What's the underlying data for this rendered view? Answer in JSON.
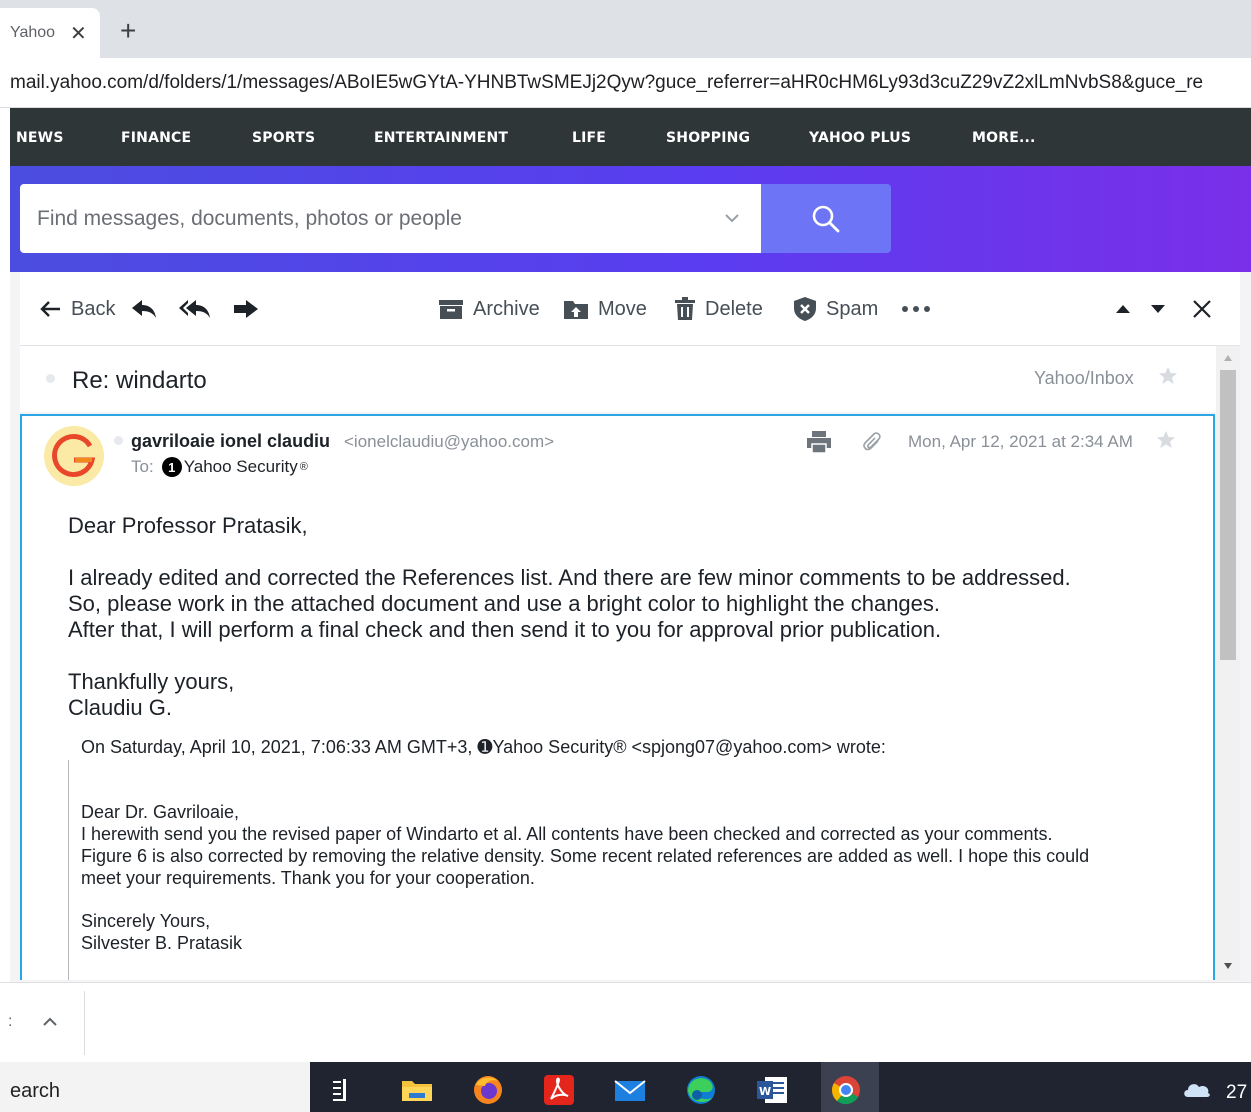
{
  "browser": {
    "tab_title": "Yahoo",
    "url": "mail.yahoo.com/d/folders/1/messages/ABoIE5wGYtA-YHNBTwSMEJj2Qyw?guce_referrer=aHR0cHM6Ly93d3cuZ29vZ2xlLmNvbS8&guce_re"
  },
  "nav": {
    "items": [
      "NEWS",
      "FINANCE",
      "SPORTS",
      "ENTERTAINMENT",
      "LIFE",
      "SHOPPING",
      "YAHOO PLUS",
      "MORE..."
    ]
  },
  "search": {
    "placeholder": "Find messages, documents, photos or people"
  },
  "toolbar": {
    "back_label": "Back",
    "archive_label": "Archive",
    "move_label": "Move",
    "delete_label": "Delete",
    "spam_label": "Spam"
  },
  "message": {
    "subject": "Re: windarto",
    "folder": "Yahoo/Inbox",
    "sender_name": "gavriloaie ionel claudiu",
    "sender_email": "<ionelclaudiu@yahoo.com>",
    "to_label": "To:",
    "to_badge": "1",
    "to_name": "Yahoo Security",
    "to_mark": "®",
    "date": "Mon, Apr 12, 2021 at 2:34 AM",
    "body": {
      "greeting": "Dear Professor Pratasik,",
      "line1": "I already edited and corrected the References list. And there are few minor comments to be addressed.",
      "line2": "So, please work in the attached document and use a bright color to highlight the changes.",
      "line3": "After that, I will perform a final check and then send it to you for approval prior publication.",
      "closing": "Thankfully yours,",
      "signature": "Claudiu G."
    },
    "quoted": {
      "header": "On Saturday, April 10, 2021, 7:06:33 AM GMT+3, ➊Yahoo Security® <spjong07@yahoo.com> wrote:",
      "greeting": "Dear Dr. Gavriloaie,",
      "line1": "I herewith send you the revised paper of Windarto et al. All contents have been checked and corrected as your comments.",
      "line2": "Figure 6 is also corrected by removing the relative density. Some recent related references are added as well. I hope this could",
      "line3": "meet your requirements. Thank you for your cooperation.",
      "closing": "Sincerely Yours,",
      "signature": "Silvester B. Pratasik"
    }
  },
  "taskbar": {
    "search_text": "earch",
    "temperature": "27"
  },
  "colors": {
    "nav_bg": "#2f3638",
    "header_gradient_start": "#4b4de0",
    "header_gradient_end": "#7a2fe8",
    "search_button": "#6d74f5",
    "message_border": "#2aa6e5"
  }
}
